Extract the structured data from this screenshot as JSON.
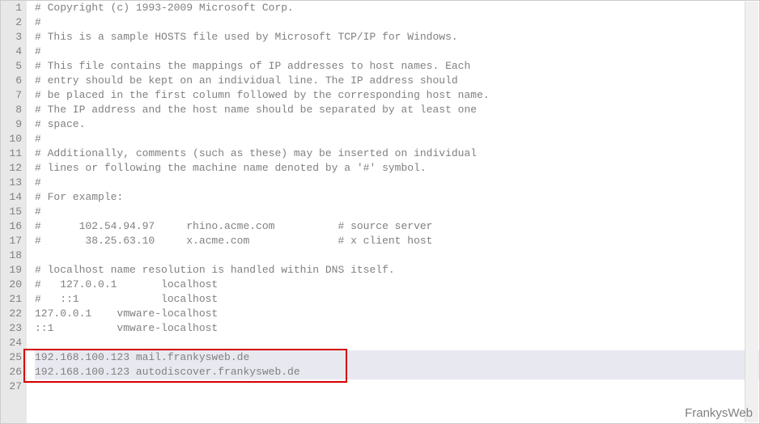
{
  "watermark": "FrankysWeb",
  "highlight": {
    "startLine": 25,
    "endLine": 26
  },
  "lines": [
    {
      "n": 1,
      "text": "# Copyright (c) 1993-2009 Microsoft Corp."
    },
    {
      "n": 2,
      "text": "#"
    },
    {
      "n": 3,
      "text": "# This is a sample HOSTS file used by Microsoft TCP/IP for Windows."
    },
    {
      "n": 4,
      "text": "#"
    },
    {
      "n": 5,
      "text": "# This file contains the mappings of IP addresses to host names. Each"
    },
    {
      "n": 6,
      "text": "# entry should be kept on an individual line. The IP address should"
    },
    {
      "n": 7,
      "text": "# be placed in the first column followed by the corresponding host name."
    },
    {
      "n": 8,
      "text": "# The IP address and the host name should be separated by at least one"
    },
    {
      "n": 9,
      "text": "# space."
    },
    {
      "n": 10,
      "text": "#"
    },
    {
      "n": 11,
      "text": "# Additionally, comments (such as these) may be inserted on individual"
    },
    {
      "n": 12,
      "text": "# lines or following the machine name denoted by a '#' symbol."
    },
    {
      "n": 13,
      "text": "#"
    },
    {
      "n": 14,
      "text": "# For example:"
    },
    {
      "n": 15,
      "text": "#"
    },
    {
      "n": 16,
      "text": "#      102.54.94.97     rhino.acme.com          # source server"
    },
    {
      "n": 17,
      "text": "#       38.25.63.10     x.acme.com              # x client host"
    },
    {
      "n": 18,
      "text": ""
    },
    {
      "n": 19,
      "text": "# localhost name resolution is handled within DNS itself."
    },
    {
      "n": 20,
      "text": "#   127.0.0.1       localhost"
    },
    {
      "n": 21,
      "text": "#   ::1             localhost"
    },
    {
      "n": 22,
      "text": "127.0.0.1    vmware-localhost"
    },
    {
      "n": 23,
      "text": "::1          vmware-localhost"
    },
    {
      "n": 24,
      "text": ""
    },
    {
      "n": 25,
      "text": "192.168.100.123 mail.frankysweb.de"
    },
    {
      "n": 26,
      "text": "192.168.100.123 autodiscover.frankysweb.de"
    },
    {
      "n": 27,
      "text": ""
    }
  ]
}
